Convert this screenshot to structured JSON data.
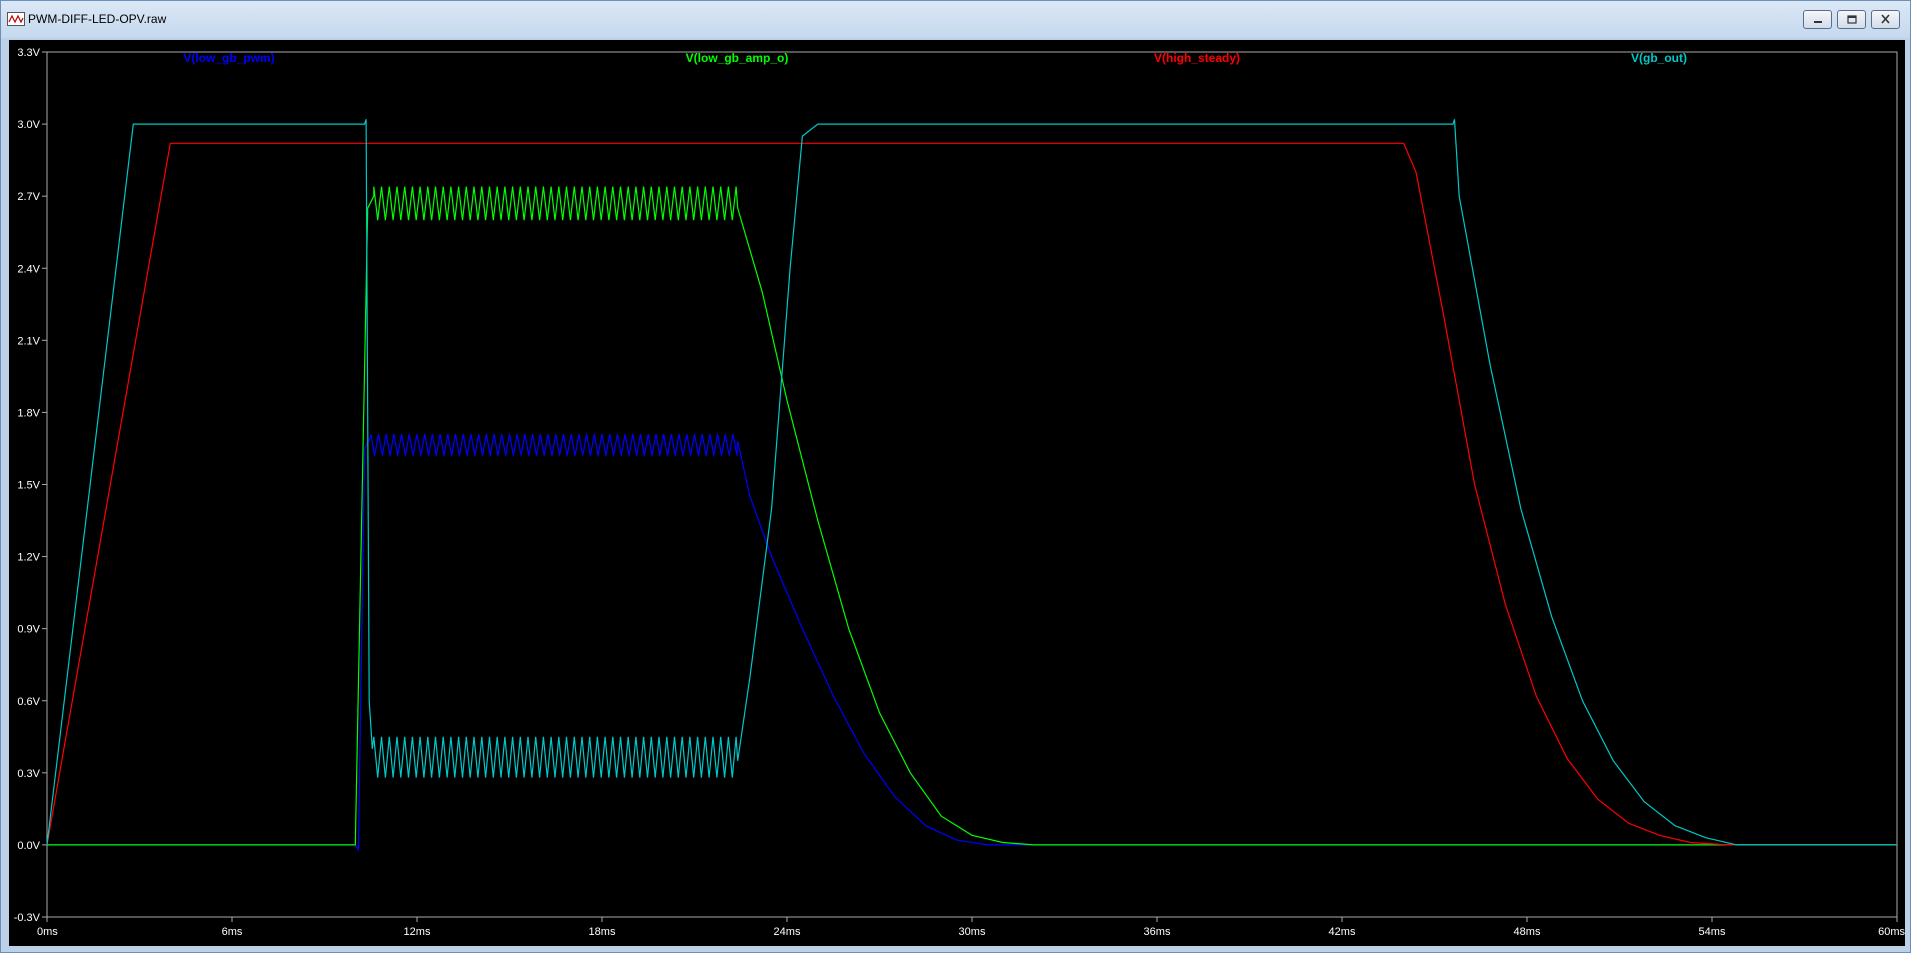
{
  "window": {
    "title": "PWM-DIFF-LED-OPV.raw",
    "app_icon": "waveform-icon",
    "buttons": {
      "minimize": "minimize-icon",
      "restore": "restore-icon",
      "close": "close-icon"
    }
  },
  "chart_data": {
    "type": "line",
    "xlabel": "",
    "ylabel": "",
    "xlim": [
      0,
      60
    ],
    "ylim": [
      -0.3,
      3.3
    ],
    "x_unit": "ms",
    "y_unit": "V",
    "xticks": [
      "0ms",
      "6ms",
      "12ms",
      "18ms",
      "24ms",
      "30ms",
      "36ms",
      "42ms",
      "48ms",
      "54ms",
      "60ms"
    ],
    "xtick_values": [
      0,
      6,
      12,
      18,
      24,
      30,
      36,
      42,
      48,
      54,
      60
    ],
    "yticks": [
      "3.3V",
      "3.0V",
      "2.7V",
      "2.4V",
      "2.1V",
      "1.8V",
      "1.5V",
      "1.2V",
      "0.9V",
      "0.6V",
      "0.3V",
      "0.0V",
      "-0.3V"
    ],
    "ytick_values": [
      3.3,
      3.0,
      2.7,
      2.4,
      2.1,
      1.8,
      1.5,
      1.2,
      0.9,
      0.6,
      0.3,
      0.0,
      -0.3
    ],
    "background": "#000000",
    "axis_color": "#aaaaaa",
    "series": [
      {
        "name": "V(low_gb_pwm)",
        "color": "#0000ff",
        "points": [
          [
            0,
            0
          ],
          [
            10.0,
            0
          ],
          [
            10.1,
            -0.02
          ],
          [
            10.3,
            1.65
          ],
          [
            10.5,
            1.7
          ]
        ],
        "ripple": {
          "start": 10.5,
          "end": 22.4,
          "low": 1.62,
          "high": 1.71,
          "period": 0.25
        },
        "tail": [
          [
            22.4,
            1.68
          ],
          [
            22.8,
            1.45
          ],
          [
            23.5,
            1.2
          ],
          [
            24.5,
            0.9
          ],
          [
            25.5,
            0.62
          ],
          [
            26.5,
            0.38
          ],
          [
            27.5,
            0.2
          ],
          [
            28.5,
            0.08
          ],
          [
            29.5,
            0.02
          ],
          [
            30.5,
            0
          ],
          [
            60,
            0
          ]
        ]
      },
      {
        "name": "V(low_gb_amp_o)",
        "color": "#00ff00",
        "points": [
          [
            0,
            0
          ],
          [
            10.0,
            0
          ],
          [
            10.4,
            2.65
          ],
          [
            10.6,
            2.7
          ]
        ],
        "ripple": {
          "start": 10.6,
          "end": 22.4,
          "low": 2.6,
          "high": 2.74,
          "period": 0.25
        },
        "tail": [
          [
            22.4,
            2.65
          ],
          [
            23.2,
            2.3
          ],
          [
            24.0,
            1.85
          ],
          [
            25.0,
            1.35
          ],
          [
            26.0,
            0.9
          ],
          [
            27.0,
            0.55
          ],
          [
            28.0,
            0.3
          ],
          [
            29.0,
            0.12
          ],
          [
            30.0,
            0.04
          ],
          [
            31.0,
            0.01
          ],
          [
            32.0,
            0
          ],
          [
            60,
            0
          ]
        ]
      },
      {
        "name": "V(high_steady)",
        "color": "#ff0000",
        "points": [
          [
            0,
            0
          ],
          [
            4.0,
            2.92
          ],
          [
            44.0,
            2.92
          ],
          [
            44.4,
            2.8
          ],
          [
            45.3,
            2.2
          ],
          [
            46.3,
            1.5
          ],
          [
            47.3,
            1.0
          ],
          [
            48.3,
            0.62
          ],
          [
            49.3,
            0.36
          ],
          [
            50.3,
            0.19
          ],
          [
            51.3,
            0.09
          ],
          [
            52.3,
            0.04
          ],
          [
            53.3,
            0.01
          ],
          [
            54.5,
            0
          ],
          [
            60,
            0
          ]
        ]
      },
      {
        "name": "V(gb_out)",
        "color": "#00c8c8",
        "points": [
          [
            0,
            0
          ],
          [
            2.8,
            3.0
          ],
          [
            10.3,
            3.0
          ],
          [
            10.35,
            3.02
          ],
          [
            10.45,
            0.6
          ],
          [
            10.55,
            0.4
          ]
        ],
        "ripple": {
          "start": 10.6,
          "end": 22.4,
          "low": 0.28,
          "high": 0.45,
          "period": 0.25
        },
        "tail": [
          [
            22.4,
            0.35
          ],
          [
            22.8,
            0.7
          ],
          [
            23.5,
            1.4
          ],
          [
            24.1,
            2.4
          ],
          [
            24.5,
            2.95
          ],
          [
            25.0,
            3.0
          ],
          [
            45.6,
            3.0
          ],
          [
            45.65,
            3.02
          ],
          [
            45.8,
            2.7
          ],
          [
            46.8,
            2.0
          ],
          [
            47.8,
            1.4
          ],
          [
            48.8,
            0.95
          ],
          [
            49.8,
            0.6
          ],
          [
            50.8,
            0.35
          ],
          [
            51.8,
            0.18
          ],
          [
            52.8,
            0.08
          ],
          [
            53.8,
            0.03
          ],
          [
            54.8,
            0
          ],
          [
            60,
            0
          ]
        ]
      }
    ]
  }
}
